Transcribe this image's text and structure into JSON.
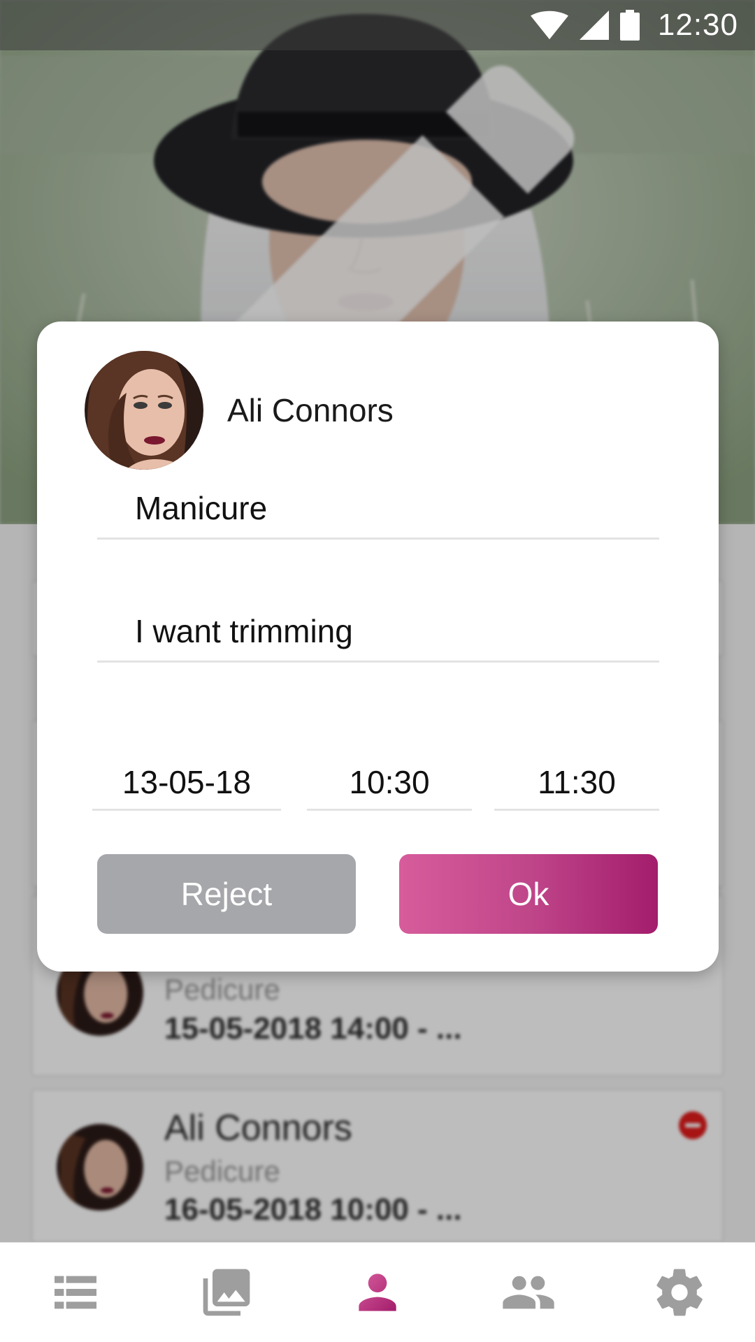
{
  "status_bar": {
    "time": "12:30"
  },
  "dialog": {
    "name": "Ali Connors",
    "service": "Manicure",
    "note": "I want trimming",
    "date": "13-05-18",
    "start_time": "10:30",
    "end_time": "11:30",
    "reject_label": "Reject",
    "ok_label": "Ok"
  },
  "background_list": {
    "items": [
      {
        "name": "",
        "service": "Pedicure",
        "datetime": "15-05-2018 14:00 - ..."
      },
      {
        "name": "Ali Connors",
        "service": "Pedicure",
        "datetime": "16-05-2018 10:00 - ...",
        "status": "rejected"
      }
    ]
  },
  "bottom_nav": {
    "items": [
      {
        "icon": "list-icon",
        "active": false
      },
      {
        "icon": "gallery-icon",
        "active": false
      },
      {
        "icon": "person-icon",
        "active": true
      },
      {
        "icon": "people-icon",
        "active": false
      },
      {
        "icon": "gear-icon",
        "active": false
      }
    ]
  },
  "colors": {
    "accent": "#c0468a",
    "accent_dark": "#a31d6c",
    "reject_gray": "#a6a7ab",
    "nav_inactive": "#9e9e9e",
    "status_red": "#e01b1b"
  }
}
